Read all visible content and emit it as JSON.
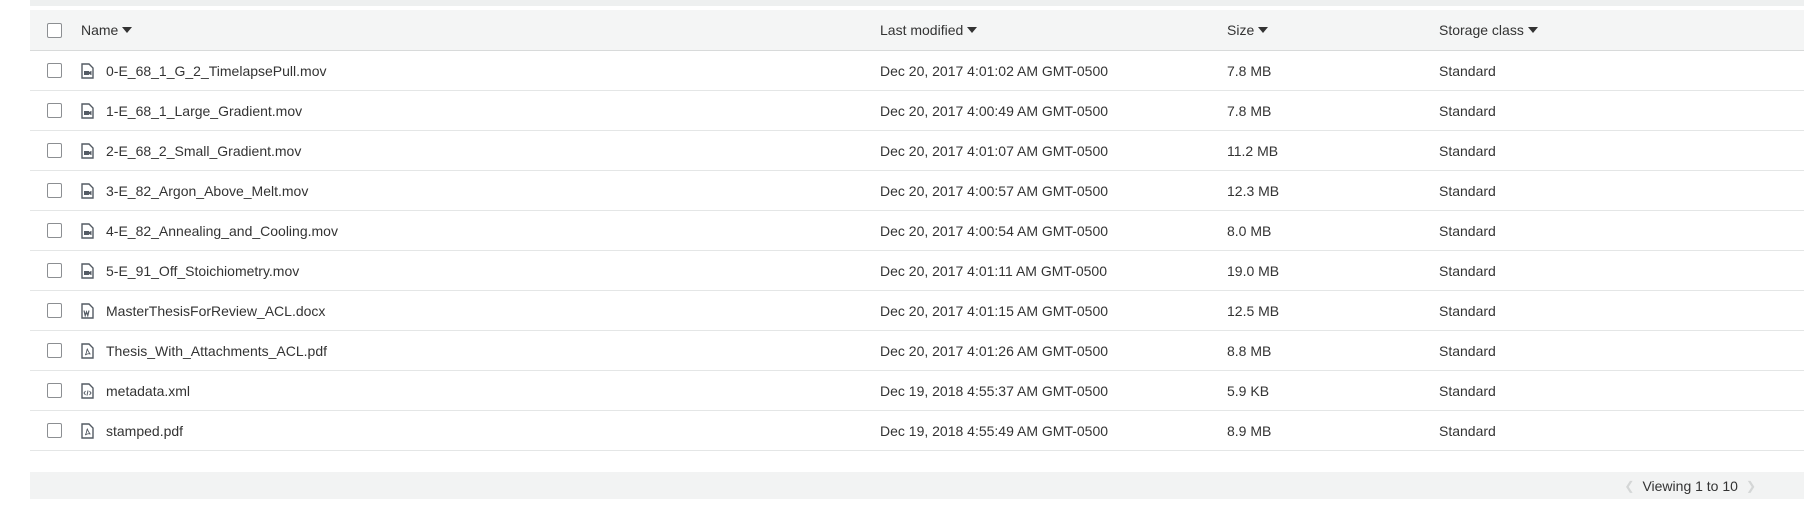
{
  "table": {
    "columns": {
      "name": "Name",
      "last_modified": "Last modified",
      "size": "Size",
      "storage_class": "Storage class"
    },
    "rows": [
      {
        "name": "0-E_68_1_G_2_TimelapsePull.mov",
        "icon": "video-file-icon",
        "modified": "Dec 20, 2017 4:01:02 AM GMT-0500",
        "size": "7.8 MB",
        "storage": "Standard"
      },
      {
        "name": "1-E_68_1_Large_Gradient.mov",
        "icon": "video-file-icon",
        "modified": "Dec 20, 2017 4:00:49 AM GMT-0500",
        "size": "7.8 MB",
        "storage": "Standard"
      },
      {
        "name": "2-E_68_2_Small_Gradient.mov",
        "icon": "video-file-icon",
        "modified": "Dec 20, 2017 4:01:07 AM GMT-0500",
        "size": "11.2 MB",
        "storage": "Standard"
      },
      {
        "name": "3-E_82_Argon_Above_Melt.mov",
        "icon": "video-file-icon",
        "modified": "Dec 20, 2017 4:00:57 AM GMT-0500",
        "size": "12.3 MB",
        "storage": "Standard"
      },
      {
        "name": "4-E_82_Annealing_and_Cooling.mov",
        "icon": "video-file-icon",
        "modified": "Dec 20, 2017 4:00:54 AM GMT-0500",
        "size": "8.0 MB",
        "storage": "Standard"
      },
      {
        "name": "5-E_91_Off_Stoichiometry.mov",
        "icon": "video-file-icon",
        "modified": "Dec 20, 2017 4:01:11 AM GMT-0500",
        "size": "19.0 MB",
        "storage": "Standard"
      },
      {
        "name": "MasterThesisForReview_ACL.docx",
        "icon": "word-file-icon",
        "modified": "Dec 20, 2017 4:01:15 AM GMT-0500",
        "size": "12.5 MB",
        "storage": "Standard"
      },
      {
        "name": "Thesis_With_Attachments_ACL.pdf",
        "icon": "pdf-file-icon",
        "modified": "Dec 20, 2017 4:01:26 AM GMT-0500",
        "size": "8.8 MB",
        "storage": "Standard"
      },
      {
        "name": "metadata.xml",
        "icon": "code-file-icon",
        "modified": "Dec 19, 2018 4:55:37 AM GMT-0500",
        "size": "5.9 KB",
        "storage": "Standard"
      },
      {
        "name": "stamped.pdf",
        "icon": "pdf-file-icon",
        "modified": "Dec 19, 2018 4:55:49 AM GMT-0500",
        "size": "8.9 MB",
        "storage": "Standard"
      }
    ]
  },
  "pagination": {
    "label": "Viewing 1 to 10",
    "prev_icon": "chevron-left-icon",
    "next_icon": "chevron-right-icon"
  },
  "colors": {
    "header_bg": "#f4f5f5",
    "border": "#e4e6e6",
    "text": "#333333",
    "icon": "#545b64"
  }
}
